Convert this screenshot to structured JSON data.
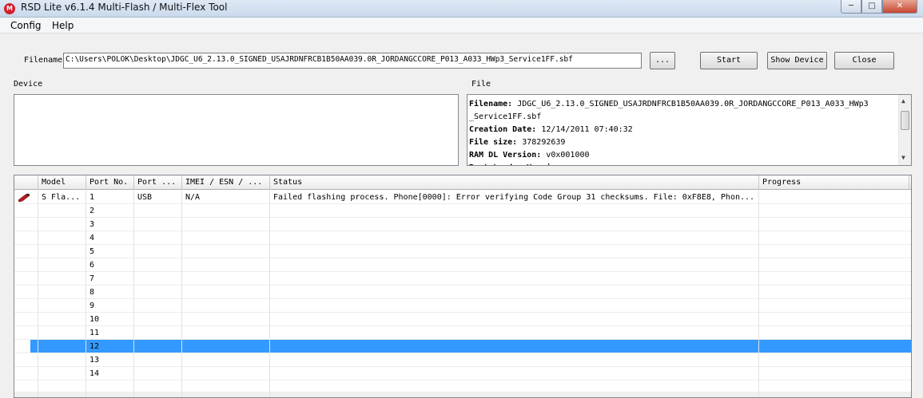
{
  "window": {
    "title": "RSD Lite v6.1.4 Multi-Flash / Multi-Flex Tool",
    "app_icon": "motorola-logo-icon",
    "controls": {
      "minimize": "─",
      "maximize": "□",
      "close": "✕"
    }
  },
  "menu": [
    "Config",
    "Help"
  ],
  "toolbar": {
    "filename_label": "Filename",
    "filename_value": "C:\\Users\\POLOK\\Desktop\\JDGC_U6_2.13.0_SIGNED_USAJRDNFRCB1B50AA039.0R_JORDANGCCORE_P013_A033_HWp3_Service1FF.sbf",
    "browse_label": "...",
    "start_label": "Start",
    "show_device_label": "Show Device",
    "close_label": "Close"
  },
  "device_panel": {
    "label": "Device"
  },
  "file_panel": {
    "label": "File",
    "lines": [
      {
        "key": "Filename:",
        "value": " JDGC_U6_2.13.0_SIGNED_USAJRDNFRCB1B50AA039.0R_JORDANGCCORE_P013_A033_HWp3"
      },
      {
        "key": "",
        "value": "_Service1FF.sbf"
      },
      {
        "key": "Creation Date:",
        "value": " 12/14/2011 07:40:32"
      },
      {
        "key": "File size:",
        "value": " 378292639"
      },
      {
        "key": "RAM DL Version:",
        "value": " v0x001000"
      },
      {
        "key": "Boot Loader Version:",
        "value": ""
      }
    ]
  },
  "grid": {
    "columns": [
      "",
      "Model",
      "Port No.",
      "Port ...",
      "IMEI / ESN / ...",
      "Status",
      "Progress"
    ],
    "rows": [
      {
        "icon": "phone-error-icon",
        "model": "S Fla...",
        "port_no": "1",
        "port_type": "USB",
        "imei": "N/A",
        "status": "Failed flashing process. Phone[0000]: Error verifying Code Group 31 checksums. File: 0xF8E8, Phon...",
        "progress": ""
      },
      {
        "icon": "",
        "model": "",
        "port_no": "2",
        "port_type": "",
        "imei": "",
        "status": "",
        "progress": ""
      },
      {
        "icon": "",
        "model": "",
        "port_no": "3",
        "port_type": "",
        "imei": "",
        "status": "",
        "progress": ""
      },
      {
        "icon": "",
        "model": "",
        "port_no": "4",
        "port_type": "",
        "imei": "",
        "status": "",
        "progress": ""
      },
      {
        "icon": "",
        "model": "",
        "port_no": "5",
        "port_type": "",
        "imei": "",
        "status": "",
        "progress": ""
      },
      {
        "icon": "",
        "model": "",
        "port_no": "6",
        "port_type": "",
        "imei": "",
        "status": "",
        "progress": ""
      },
      {
        "icon": "",
        "model": "",
        "port_no": "7",
        "port_type": "",
        "imei": "",
        "status": "",
        "progress": ""
      },
      {
        "icon": "",
        "model": "",
        "port_no": "8",
        "port_type": "",
        "imei": "",
        "status": "",
        "progress": ""
      },
      {
        "icon": "",
        "model": "",
        "port_no": "9",
        "port_type": "",
        "imei": "",
        "status": "",
        "progress": ""
      },
      {
        "icon": "",
        "model": "",
        "port_no": "10",
        "port_type": "",
        "imei": "",
        "status": "",
        "progress": ""
      },
      {
        "icon": "",
        "model": "",
        "port_no": "11",
        "port_type": "",
        "imei": "",
        "status": "",
        "progress": ""
      },
      {
        "icon": "",
        "model": "",
        "port_no": "12",
        "port_type": "",
        "imei": "",
        "status": "",
        "progress": "",
        "selected": true
      },
      {
        "icon": "",
        "model": "",
        "port_no": "13",
        "port_type": "",
        "imei": "",
        "status": "",
        "progress": ""
      },
      {
        "icon": "",
        "model": "",
        "port_no": "14",
        "port_type": "",
        "imei": "",
        "status": "",
        "progress": ""
      }
    ]
  },
  "colors": {
    "selection": "#3399ff",
    "close_button": "#c7462f",
    "brand": "#d4202a"
  }
}
